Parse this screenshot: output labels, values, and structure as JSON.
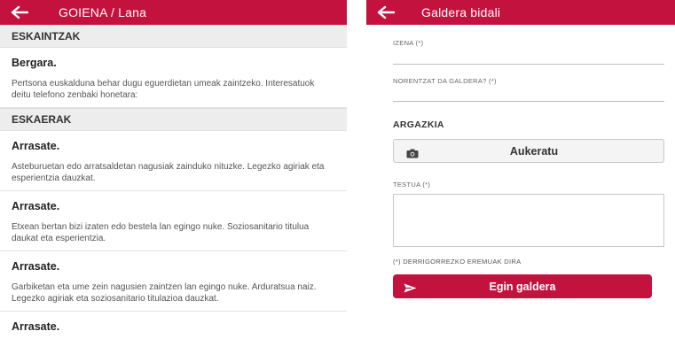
{
  "left": {
    "appbar": {
      "title": "GOIENA / Lana",
      "back_icon": "arrow-left-icon"
    },
    "sections": [
      {
        "header": "ESKAINTZAK",
        "items": [
          {
            "title": "Bergara.",
            "body": "Pertsona euskalduna behar dugu eguerdietan umeak zaintzeko. Interesatuok deitu telefono zenbaki honetara:"
          }
        ]
      },
      {
        "header": "ESKAERAK",
        "items": [
          {
            "title": "Arrasate.",
            "body": "Asteburuetan edo arratsaldetan nagusiak zainduko nituzke. Legezko agiriak eta esperientzia dauzkat."
          },
          {
            "title": "Arrasate.",
            "body": "Etxean bertan bizi izaten edo bestela lan egingo nuke. Soziosanitario titulua daukat eta esperientzia."
          },
          {
            "title": "Arrasate.",
            "body": "Garbiketan eta ume zein nagusien zaintzen lan egingo nuke. Arduratsua naiz. Legezko agiriak eta soziosanitario titulazioa dauzkat."
          },
          {
            "title": "Arrasate."
          }
        ]
      }
    ]
  },
  "right": {
    "appbar": {
      "title": "Galdera bidali",
      "back_icon": "arrow-left-icon"
    },
    "form": {
      "name_label": "IZENA (*)",
      "recipient_label": "NORENTZAT DA GALDERA? (*)",
      "photo_title": "ARGAZKIA",
      "pick_label": "Aukeratu",
      "pick_icon": "camera-icon",
      "text_label": "TESTUA (*)",
      "required_note": "(*) DERRIGORREZKO EREMUAK DIRA",
      "submit_label": "Egin galdera",
      "submit_icon": "send-icon"
    }
  },
  "colors": {
    "brand": "#c4123f",
    "section_bg": "#ededed"
  }
}
